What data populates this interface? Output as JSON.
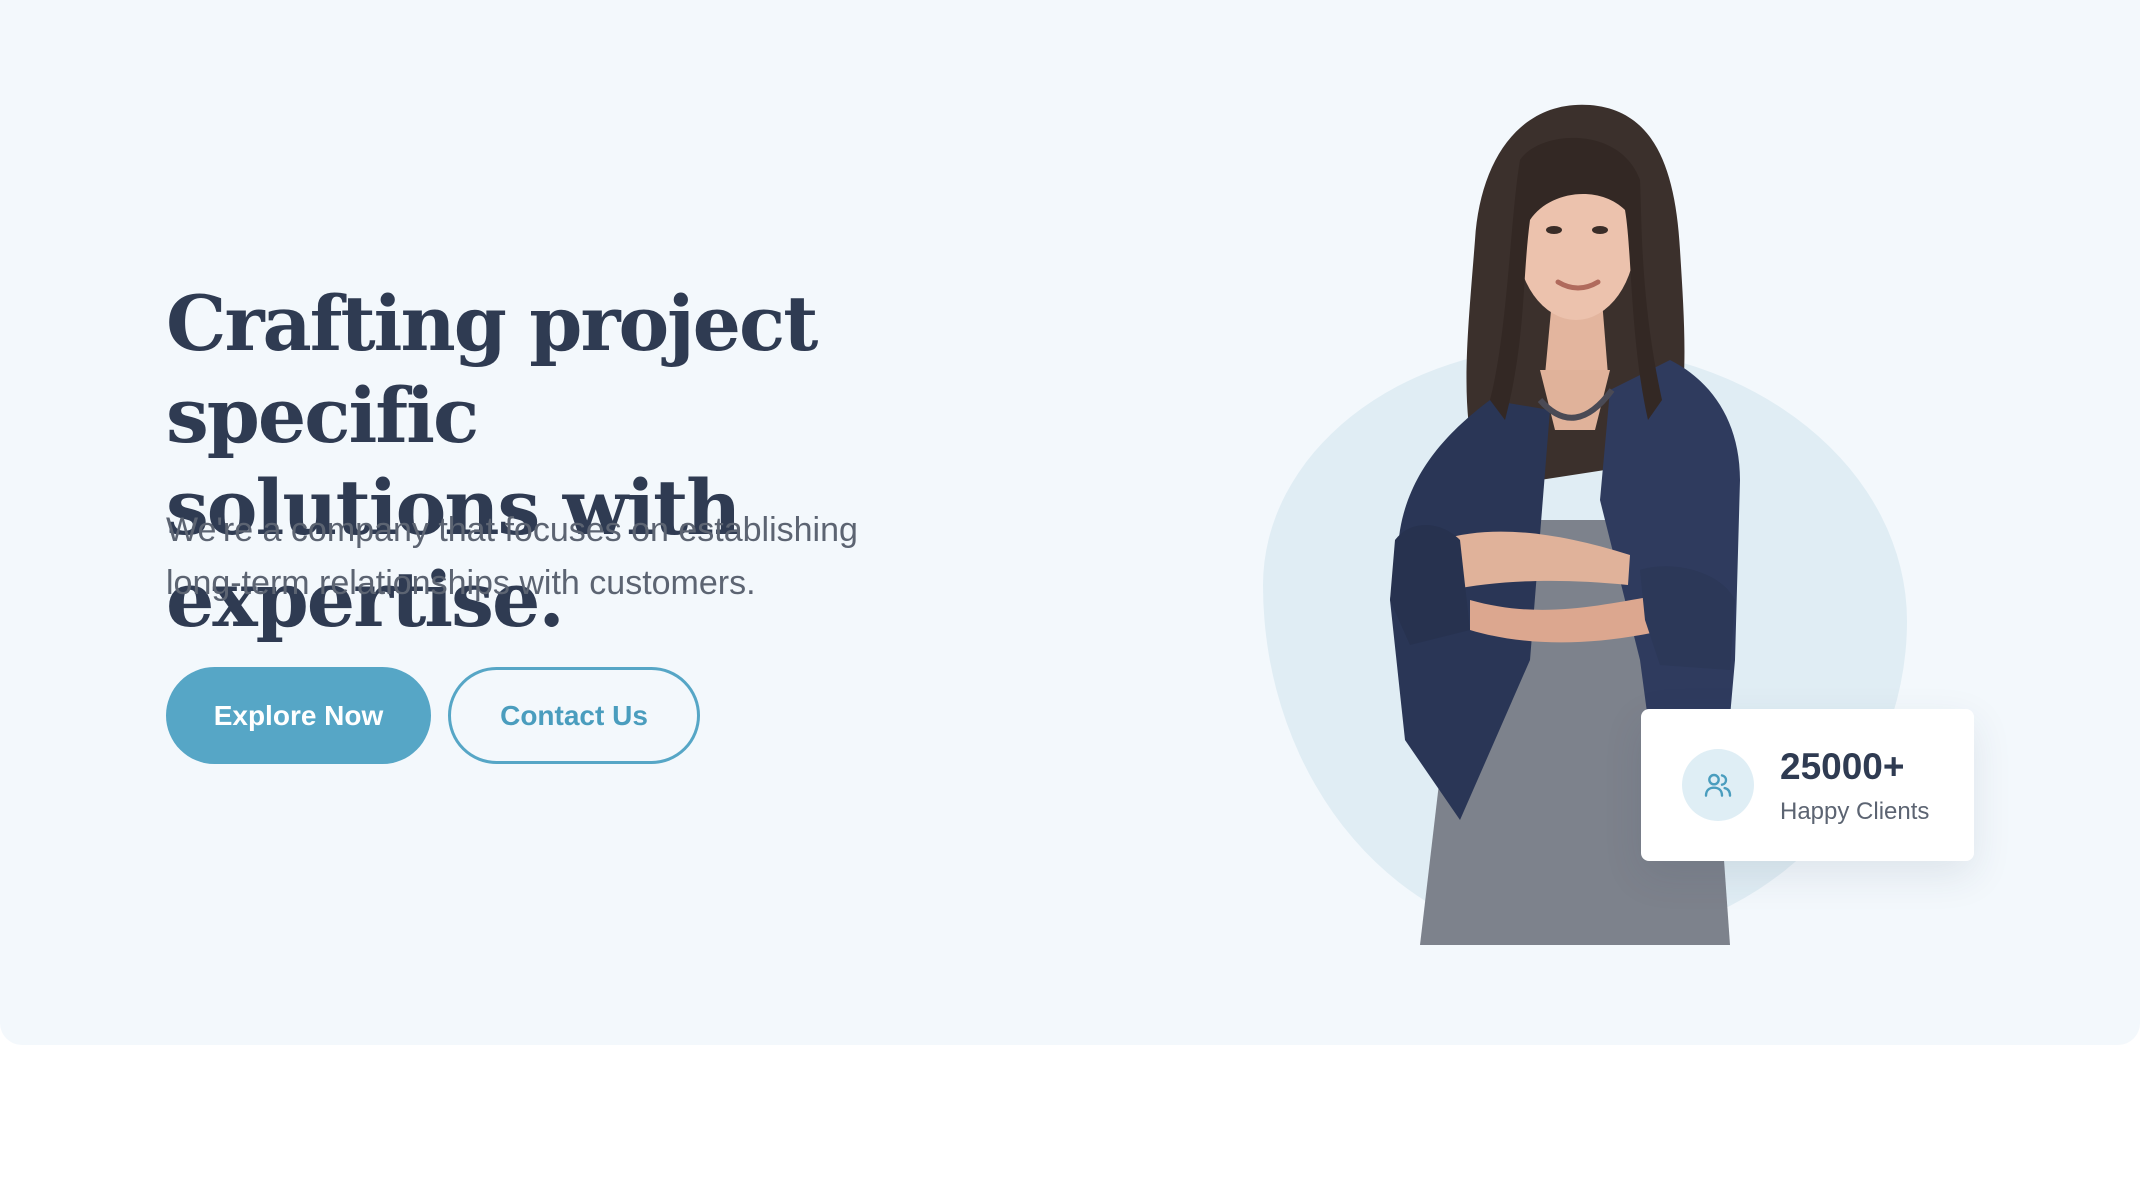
{
  "hero": {
    "headline_line1": "Crafting project specific",
    "headline_line2": "solutions with expertise.",
    "subtitle_line1": "We're a company that focuses on establishing",
    "subtitle_line2": "long-term relationships with customers.",
    "primary_button": "Explore Now",
    "secondary_button": "Contact Us"
  },
  "stats_card": {
    "value": "25000+",
    "label": "Happy Clients",
    "icon": "users-icon"
  },
  "colors": {
    "background": "#f3f8fc",
    "headline": "#2f3b52",
    "body_text": "#5c6472",
    "accent": "#56a6c6",
    "blob": "#e0edf4",
    "card": "#ffffff"
  }
}
